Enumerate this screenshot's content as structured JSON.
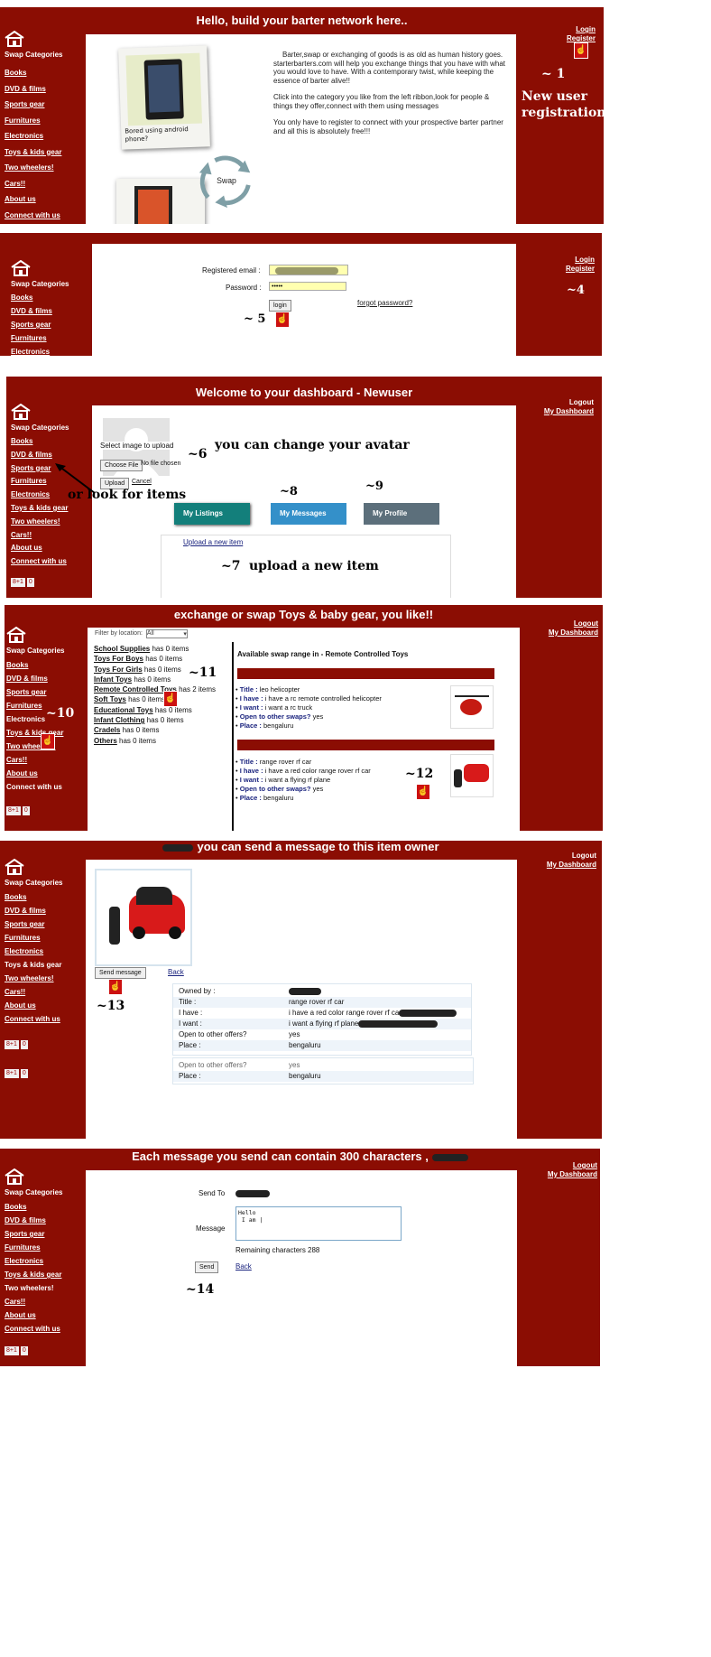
{
  "sidebar": {
    "title": "Swap Categories",
    "items": [
      "Books",
      "DVD & films",
      "Sports gear",
      "Furnitures",
      "Electronics",
      "Toys & kids gear",
      "Two wheelers!",
      "Cars!!",
      "About us",
      "Connect with us"
    ],
    "share": [
      "8+1",
      "0"
    ]
  },
  "links": {
    "login": "Login",
    "register": "Register",
    "logout": "Logout",
    "dashboard": "My Dashboard"
  },
  "home": {
    "title": "Hello, build your barter network here..",
    "para1": "Barter,swap or exchanging of goods is as old as human history goes. starterbarters.com will help you exchange things that you have with what you would love to have. With a contemporary twist, while keeping the essence of barter alive!!",
    "para2": "Click into the category you like from the left ribbon,look for people & things they offer,connect with them using messages",
    "para3": "You only have to register to connect with your prospective barter partner and all this is absolutely free!!!",
    "polaroid_caption": "Bored using android phone?",
    "swap_label": "Swap",
    "anno_1": "~ 1",
    "anno_new_user": "New user registration"
  },
  "login": {
    "email_label": "Registered email :",
    "password_label": "Password :",
    "password_value": "•••••",
    "login_button": "login",
    "forgot": "forgot password?",
    "anno_4": "~4",
    "anno_5": "~ 5"
  },
  "dashboard": {
    "title": "Welcome to your dashboard - Newuser",
    "select_image": "Select image to upload",
    "choose_file": "Choose File",
    "no_file": "No file chosen",
    "upload": "Upload",
    "cancel": "Cancel",
    "my_listings": "My Listings",
    "my_messages": "My Messages",
    "my_profile": "My Profile",
    "upload_new": "Upload a new item",
    "anno_6": "~6",
    "anno_avatar": "you can change your avatar",
    "anno_look": "or look for items",
    "anno_8": "~8",
    "anno_9": "~9",
    "anno_7": "~7",
    "anno_upload": "upload a new item"
  },
  "browse": {
    "title": "exchange or swap Toys & baby gear, you like!!",
    "filter_label": "Filter by location:",
    "filter_value": "All",
    "categories": [
      {
        "name": "School Supplies",
        "count": "has 0 items"
      },
      {
        "name": "Toys For Boys",
        "count": "has 0 items"
      },
      {
        "name": "Toys For Girls",
        "count": "has 0 items"
      },
      {
        "name": "Infant Toys",
        "count": "has 0 items"
      },
      {
        "name": "Remote Controlled Toys",
        "count": "has 2 items"
      },
      {
        "name": "Soft Toys",
        "count": "has 0 items"
      },
      {
        "name": "Educational Toys",
        "count": "has 0 items"
      },
      {
        "name": "Infant Clothing",
        "count": "has 0 items"
      },
      {
        "name": "Cradels",
        "count": "has 0 items"
      },
      {
        "name": "Others",
        "count": "has 0 items"
      }
    ],
    "range_title": "Available swap range in - Remote Controlled Toys",
    "item1": {
      "k1": "Title :",
      "v1": "leo helicopter",
      "k2": "I have :",
      "v2": "i have a rc remote controlled helicopter",
      "k3": "I want :",
      "v3": "i want a rc truck",
      "k4": "Open to other swaps?",
      "v4": "yes",
      "k5": "Place :",
      "v5": "bengaluru"
    },
    "item2": {
      "k1": "Title :",
      "v1": "range rover rf car",
      "k2": "I have :",
      "v2": "i have a red color range rover rf car",
      "k3": "I want :",
      "v3": "i want a flying rf plane",
      "k4": "Open to other swaps?",
      "v4": "yes",
      "k5": "Place :",
      "v5": "bengaluru"
    },
    "anno_11": "~11",
    "anno_10": "~10",
    "anno_12": "~12"
  },
  "detail": {
    "title": "you can send a message to this item owner",
    "send_message": "Send message",
    "back": "Back",
    "rows": [
      {
        "k": "Owned by :",
        "v": ""
      },
      {
        "k": "Title :",
        "v": "range rover rf car"
      },
      {
        "k": "I have :",
        "v": "i have a red color range rover rf ca"
      },
      {
        "k": "I want :",
        "v": "i want a flying rf plane"
      },
      {
        "k": "Open to other offers?",
        "v": "yes"
      },
      {
        "k": "Place :",
        "v": "bengaluru"
      }
    ],
    "dup_rows": [
      {
        "k": "Open to other offers?",
        "v": "yes"
      },
      {
        "k": "Place :",
        "v": "bengaluru"
      }
    ],
    "anno_13": "~13"
  },
  "message": {
    "title": "Each message you send can contain 300 characters ,",
    "send_to": "Send To",
    "message_label": "Message",
    "message_value": "Hello\n I am |",
    "remaining": "Remaining characters 288",
    "send": "Send",
    "back": "Back",
    "anno_14": "~14"
  },
  "colors": {
    "brand": "#8b0d03",
    "teal": "#137f7b",
    "blue": "#3490c9",
    "slate": "#5c6f7b",
    "field": "#ffffb0"
  }
}
